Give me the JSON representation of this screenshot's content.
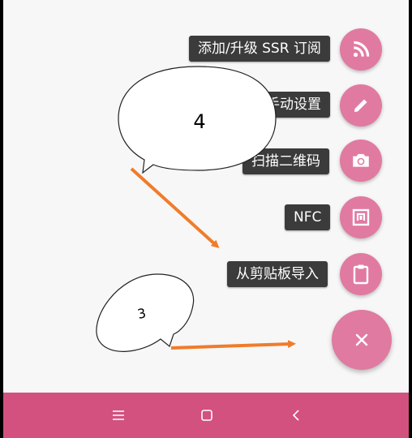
{
  "fab_menu": {
    "items": [
      {
        "label": "添加/升级 SSR 订阅",
        "icon": "rss-icon"
      },
      {
        "label": "手动设置",
        "icon": "pencil-icon"
      },
      {
        "label": "扫描二维码",
        "icon": "camera-icon"
      },
      {
        "label": "NFC",
        "icon": "nfc-icon"
      },
      {
        "label": "从剪贴板导入",
        "icon": "clipboard-icon"
      }
    ],
    "main_button_icon": "close-icon"
  },
  "annotations": {
    "callout_4": "4",
    "callout_3": "3"
  },
  "navbar": {
    "buttons": [
      "menu-icon",
      "home-icon",
      "back-icon"
    ]
  },
  "colors": {
    "fab": "#e17aa0",
    "navbar": "#d3517f",
    "label_bg": "#3b3b3b",
    "arrow": "#f07c2a"
  }
}
